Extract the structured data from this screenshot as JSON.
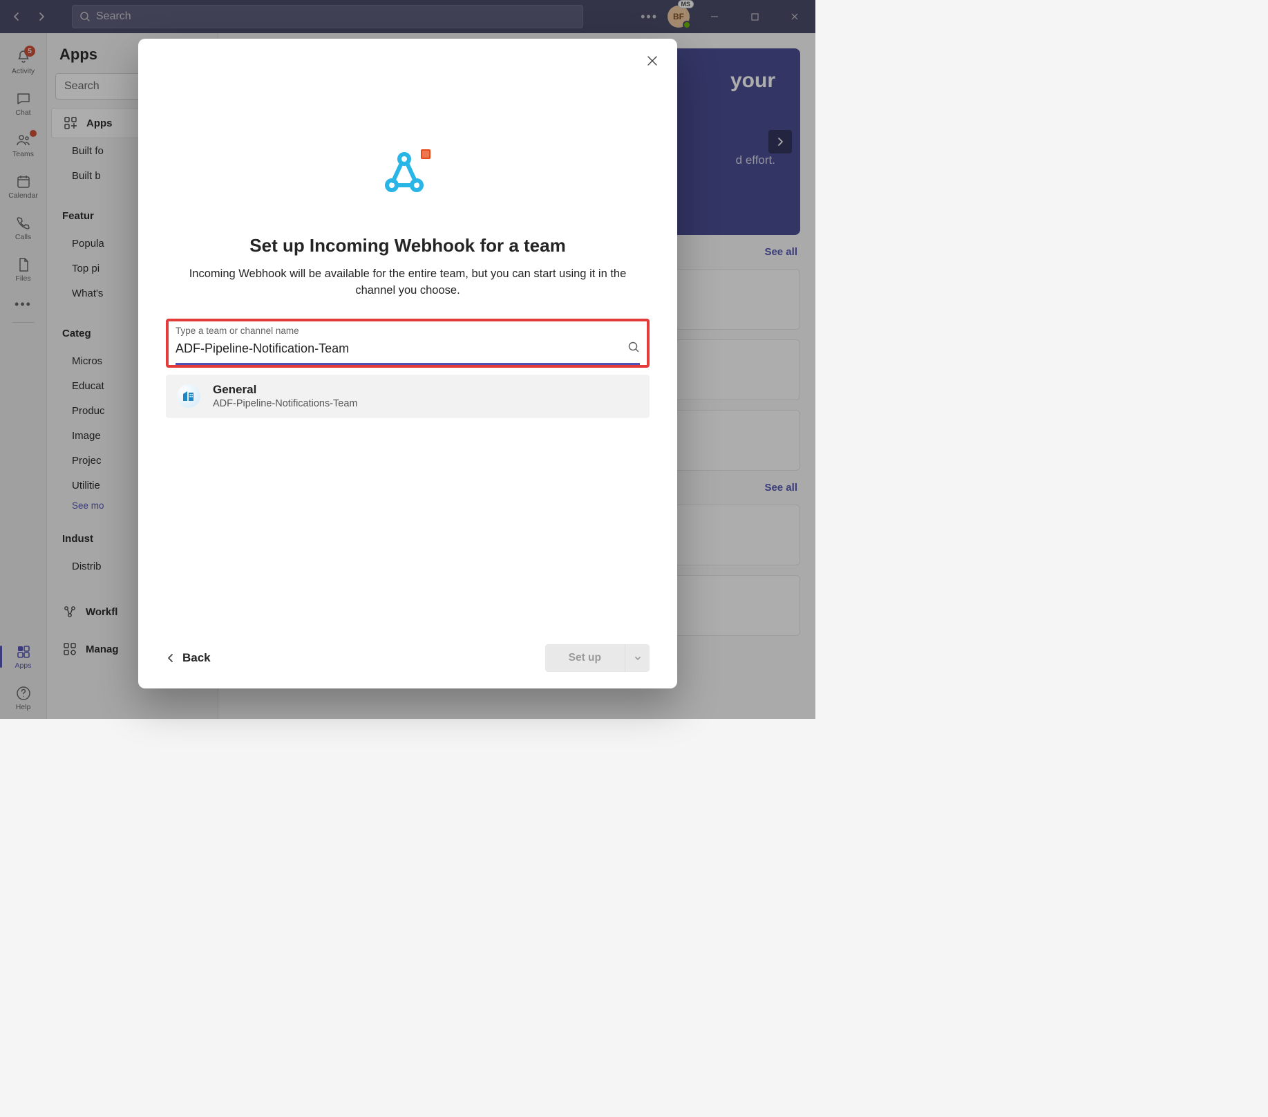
{
  "titlebar": {
    "search_placeholder": "Search",
    "avatar_initials": "BF",
    "avatar_badge": "MS"
  },
  "rail": {
    "activity": "Activity",
    "activity_badge": "5",
    "chat": "Chat",
    "teams": "Teams",
    "calendar": "Calendar",
    "calls": "Calls",
    "files": "Files",
    "apps": "Apps",
    "help": "Help"
  },
  "leftpanel": {
    "title": "Apps",
    "search": "Search",
    "apps_label": "Apps",
    "built_for": "Built fo",
    "built_by": "Built b",
    "featured_header": "Featur",
    "featured": [
      "Popula",
      "Top pi",
      "What's"
    ],
    "categories_header": "Categ",
    "categories": [
      "Micros",
      "Educat",
      "Produc",
      "Image",
      "Projec",
      "Utilitie"
    ],
    "see_more": "See mo",
    "industries_header": "Indust",
    "industries": [
      "Distrib"
    ],
    "workflow": "Workfl",
    "manage": "Manag"
  },
  "main": {
    "hero_title": "your",
    "hero_sub": "d effort.",
    "see_all": "See all"
  },
  "modal": {
    "title": "Set up Incoming Webhook for a team",
    "subtitle": "Incoming Webhook will be available for the entire team, but you can start using it in the channel you choose.",
    "field_label": "Type a team or channel name",
    "field_value": "ADF-Pipeline-Notification-Team",
    "result_title": "General",
    "result_sub": "ADF-Pipeline-Notifications-Team",
    "back": "Back",
    "setup": "Set up"
  }
}
